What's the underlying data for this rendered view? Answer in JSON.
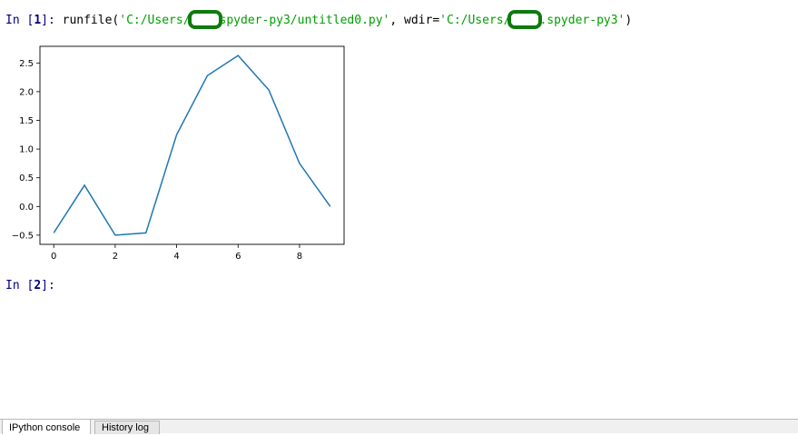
{
  "console": {
    "cell1": {
      "prompt_prefix": "In [",
      "prompt_number": "1",
      "prompt_suffix": "]: ",
      "func": "runfile(",
      "arg1_part1": "'C:/Users/",
      "arg1_part2": "spyder-py3/untitled0.py'",
      "sep": ", wdir=",
      "arg2_part1": "'C:/Users/",
      "arg2_part2": ".spyder-py3'",
      "close": ")"
    },
    "cell2": {
      "prompt_prefix": "In [",
      "prompt_number": "2",
      "prompt_suffix": "]:"
    }
  },
  "tabs": {
    "ipython": "IPython console",
    "history": "History log"
  },
  "colors": {
    "prompt": "#000080",
    "string": "#00a000",
    "redaction": "#0e7a0e",
    "line": "#1f77b4"
  },
  "chart_data": {
    "type": "line",
    "x": [
      0,
      1,
      2,
      3,
      4,
      5,
      6,
      7,
      8,
      9
    ],
    "series": [
      {
        "values": [
          -0.46,
          0.37,
          -0.5,
          -0.46,
          1.25,
          2.28,
          2.63,
          2.03,
          0.75,
          0.0
        ]
      }
    ],
    "xlim": [
      -0.45,
      9.45
    ],
    "ylim": [
      -0.66,
      2.79
    ],
    "xticks": [
      0,
      2,
      4,
      6,
      8
    ],
    "yticks": [
      -0.5,
      0.0,
      0.5,
      1.0,
      1.5,
      2.0,
      2.5
    ],
    "xtick_labels": [
      "0",
      "2",
      "4",
      "6",
      "8"
    ],
    "ytick_labels": [
      "−0.5",
      "0.0",
      "0.5",
      "1.0",
      "1.5",
      "2.0",
      "2.5"
    ],
    "grid": false,
    "title": "",
    "xlabel": "",
    "ylabel": ""
  }
}
